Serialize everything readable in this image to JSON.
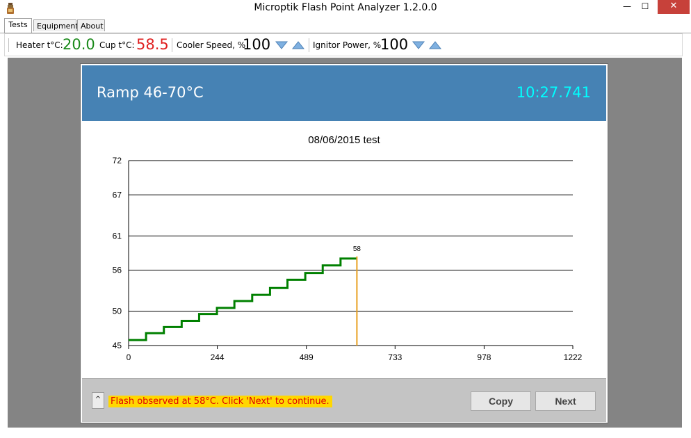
{
  "window": {
    "title": "Microptik Flash Point Analyzer 1.2.0.0",
    "minimize_glyph": "—",
    "maximize_glyph": "☐",
    "close_glyph": "✕"
  },
  "tabs": [
    {
      "label": "Tests",
      "active": true
    },
    {
      "label": "Equipment",
      "active": false
    },
    {
      "label": "About",
      "active": false
    }
  ],
  "toolbar": {
    "heater_label": "Heater t°C:",
    "heater_value": "20.0",
    "heater_color": "#1a8a1a",
    "cup_label": "Cup t°C:",
    "cup_value": "58.5",
    "cup_color": "#e02020",
    "cooler_label": "Cooler Speed, %",
    "cooler_value": "100",
    "ignitor_label": "Ignitor Power, %",
    "ignitor_value": "100"
  },
  "header": {
    "test_name": "Ramp 46-70°C",
    "timer": "10:27.741",
    "bg_color": "#4682b4",
    "timer_color": "#00ffff"
  },
  "chart_data": {
    "type": "line",
    "title": "08/06/2015 test",
    "xlabel": "",
    "ylabel": "",
    "x_ticks": [
      "0",
      "244",
      "489",
      "733",
      "978",
      "1222"
    ],
    "y_ticks": [
      "45",
      "50",
      "56",
      "61",
      "67",
      "72"
    ],
    "xlim": [
      0,
      1222
    ],
    "ylim": [
      45,
      72
    ],
    "grid": "horizontal",
    "series": [
      {
        "color": "#008000",
        "style": "step",
        "x": [
          0,
          48,
          97,
          146,
          194,
          243,
          291,
          340,
          389,
          437,
          486,
          534,
          583,
          628
        ],
        "y": [
          45.8,
          46.8,
          47.7,
          48.6,
          49.6,
          50.5,
          51.5,
          52.4,
          53.4,
          54.6,
          55.6,
          56.7,
          57.7,
          57.7
        ]
      }
    ],
    "flash_marker": {
      "x": 628,
      "value": 58,
      "label": "58",
      "color": "#e8a020"
    }
  },
  "footer": {
    "toggle_glyph": "^",
    "status_message": "Flash observed at 58°C. Click 'Next' to continue.",
    "copy_label": "Copy",
    "next_label": "Next"
  }
}
